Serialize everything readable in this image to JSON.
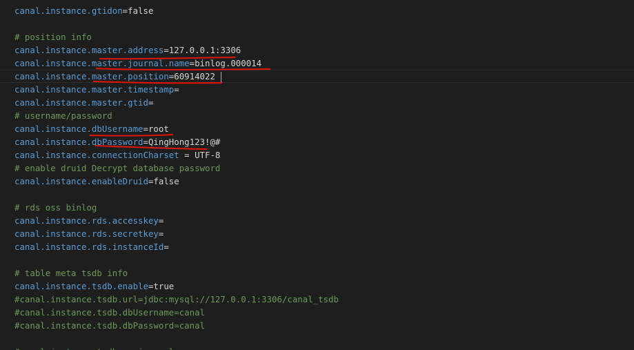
{
  "editor": {
    "lines": [
      {
        "key": "canal.instance.gtidon",
        "value": "=false"
      },
      {
        "empty": true
      },
      {
        "comment": "# position info"
      },
      {
        "key": "canal.instance.master.address",
        "value": "=127.0.0.1:3306"
      },
      {
        "key": "canal.instance.master.journal.name",
        "value": "=binlog.000014"
      },
      {
        "key": "canal.instance.master.position",
        "value": "=60914022"
      },
      {
        "key": "canal.instance.master.timestamp",
        "value": "="
      },
      {
        "key": "canal.instance.master.gtid",
        "value": "="
      },
      {
        "comment": "# username/password"
      },
      {
        "key": "canal.instance.dbUsername",
        "value": "=root"
      },
      {
        "key": "canal.instance.dbPassword",
        "value": "=QingHong123!@#"
      },
      {
        "key": "canal.instance.connectionCharset",
        "value": " = UTF-8"
      },
      {
        "comment": "# enable druid Decrypt database password"
      },
      {
        "key": "canal.instance.enableDruid",
        "value": "=false"
      },
      {
        "empty": true
      },
      {
        "comment": "# rds oss binlog"
      },
      {
        "key": "canal.instance.rds.accesskey",
        "value": "="
      },
      {
        "key": "canal.instance.rds.secretkey",
        "value": "="
      },
      {
        "key": "canal.instance.rds.instanceId",
        "value": "="
      },
      {
        "empty": true
      },
      {
        "comment": "# table meta tsdb info"
      },
      {
        "key": "canal.instance.tsdb.enable",
        "value": "=true"
      },
      {
        "comment": "#canal.instance.tsdb.url=jdbc:mysql://127.0.0.1:3306/canal_tsdb"
      },
      {
        "comment": "#canal.instance.tsdb.dbUsername=canal"
      },
      {
        "comment": "#canal.instance.tsdb.dbPassword=canal"
      },
      {
        "empty": true
      },
      {
        "comment": "#canal.instance.tsdb.spring.xml"
      }
    ],
    "current_line_index": 5,
    "colors": {
      "background": "#1e1e1e",
      "key": "#569cd6",
      "value": "#d4d4d4",
      "comment": "#6a9955",
      "annotation": "#e51400"
    }
  }
}
